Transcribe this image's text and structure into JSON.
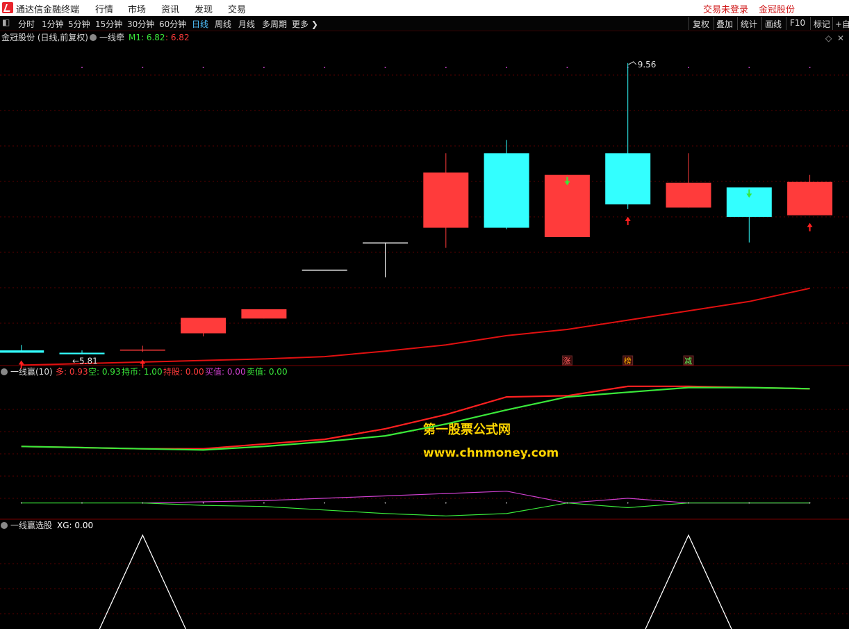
{
  "menu": {
    "app_title": "通达信金融终端",
    "items": [
      "行情",
      "市场",
      "资讯",
      "发现",
      "交易"
    ],
    "right": [
      "交易未登录",
      "金冠股份"
    ]
  },
  "toolbar": {
    "periods": [
      "分时",
      "1分钟",
      "5分钟",
      "15分钟",
      "30分钟",
      "60分钟",
      "日线",
      "周线",
      "月线",
      "多周期",
      "更多 ❯"
    ],
    "active_period": "日线",
    "right_buttons": [
      "复权",
      "叠加",
      "统计",
      "画线",
      "F10",
      "标记",
      "+自"
    ]
  },
  "colors": {
    "up": "#ff3b3b",
    "down": "#33ffff",
    "ma": "#e01010",
    "line_red": "#ff2020",
    "line_green": "#3ae83a",
    "line_purple": "#d040d0",
    "grid": "#5a0000"
  },
  "chart_data": [
    {
      "type": "candlestick",
      "title": "金冠股份 (日线,前复权)",
      "indicator_name": "一线牵",
      "legend": [
        {
          "label": "M1: 6.82",
          "color": "#3ae83a"
        },
        {
          "label": ": 6.82",
          "color": "#ff3b3b"
        }
      ],
      "ylim": [
        5.7,
        9.8
      ],
      "candles": [
        {
          "o": 5.86,
          "h": 5.93,
          "l": 5.83,
          "c": 5.83
        },
        {
          "o": 5.83,
          "h": 5.86,
          "l": 5.81,
          "c": 5.81
        },
        {
          "o": 5.86,
          "h": 5.92,
          "l": 5.84,
          "c": 5.87
        },
        {
          "o": 6.08,
          "h": 6.23,
          "l": 6.04,
          "c": 6.28
        },
        {
          "o": 6.27,
          "h": 6.38,
          "l": 6.27,
          "c": 6.39
        },
        {
          "o": 6.9,
          "h": 6.9,
          "l": 6.9,
          "c": 6.9
        },
        {
          "o": 7.25,
          "h": 7.25,
          "l": 6.8,
          "c": 7.25
        },
        {
          "o": 7.44,
          "h": 8.4,
          "l": 7.18,
          "c": 8.15
        },
        {
          "o": 8.4,
          "h": 8.57,
          "l": 7.42,
          "c": 7.44
        },
        {
          "o": 7.32,
          "h": 8.12,
          "l": 7.32,
          "c": 8.12
        },
        {
          "o": 8.4,
          "h": 9.56,
          "l": 7.68,
          "c": 7.74
        },
        {
          "o": 7.7,
          "h": 8.4,
          "l": 7.7,
          "c": 8.02
        },
        {
          "o": 7.96,
          "h": 7.96,
          "l": 7.25,
          "c": 7.58
        },
        {
          "o": 7.6,
          "h": 8.12,
          "l": 7.6,
          "c": 8.03
        }
      ],
      "ma": [
        5.67,
        5.69,
        5.71,
        5.73,
        5.75,
        5.78,
        5.85,
        5.93,
        6.05,
        6.13,
        6.25,
        6.37,
        6.49,
        6.66
      ],
      "marks": {
        "up_arrows": [
          0,
          2,
          10,
          13
        ],
        "down_arrows": [
          9,
          12
        ],
        "flat_arrows": [
          12
        ]
      },
      "annotations": [
        {
          "text": "9.56",
          "candle": 10
        },
        {
          "text": "←5.81",
          "candle": 1
        }
      ],
      "tags": [
        {
          "text": "涨",
          "candle": 9
        },
        {
          "text": "榜",
          "candle": 10
        },
        {
          "text": "减",
          "candle": 11
        }
      ]
    },
    {
      "type": "line",
      "title": "一线赢(10)",
      "legend": [
        {
          "label": "多: 0.93",
          "color": "#ff3b3b"
        },
        {
          "label": "空: 0.93",
          "color": "#3ae83a"
        },
        {
          "label": "持币: 1.00",
          "color": "#3ae83a"
        },
        {
          "label": "持股: 0.00",
          "color": "#ff3b3b"
        },
        {
          "label": "买值: 0.00",
          "color": "#d040d0"
        },
        {
          "label": "卖值: 0.00",
          "color": "#3ae83a"
        }
      ],
      "ylim": [
        -0.12,
        1.06
      ],
      "series": [
        {
          "name": "多",
          "color": "#ff2020",
          "values": [
            0.48,
            0.47,
            0.46,
            0.46,
            0.5,
            0.54,
            0.63,
            0.75,
            0.9,
            0.91,
            0.99,
            0.99,
            0.98,
            0.97,
            0.93
          ]
        },
        {
          "name": "空",
          "color": "#3ae83a",
          "values": [
            0.48,
            0.47,
            0.46,
            0.45,
            0.48,
            0.52,
            0.57,
            0.67,
            0.79,
            0.9,
            0.94,
            0.98,
            0.98,
            0.97,
            0.93
          ]
        },
        {
          "name": "买值",
          "color": "#d040d0",
          "values": [
            null,
            null,
            0.0,
            0.01,
            0.02,
            0.04,
            0.06,
            0.08,
            0.1,
            0.0,
            0.04,
            0.0,
            0.0,
            0.0,
            null
          ]
        },
        {
          "name": "卖值",
          "color": "#3ae83a",
          "values": [
            0.0,
            0.0,
            0.0,
            -0.02,
            -0.03,
            -0.06,
            -0.09,
            -0.11,
            -0.09,
            0.0,
            -0.04,
            0.0,
            0.0,
            0.0,
            0.0
          ]
        }
      ],
      "x": [
        0,
        1,
        2,
        3,
        4,
        5,
        6,
        7,
        8,
        9,
        10,
        11,
        12,
        13,
        14
      ]
    },
    {
      "type": "line",
      "title": "一线赢选股",
      "legend": [
        {
          "label": "XG: 0.00",
          "color": "#ffffff"
        }
      ],
      "ylim": [
        0,
        1
      ],
      "peaks_at_candle": [
        2,
        11
      ]
    }
  ],
  "watermark": {
    "line1": "第一股票公式网",
    "line2": "www.chnmoney.com",
    "color": "#ffd700"
  }
}
